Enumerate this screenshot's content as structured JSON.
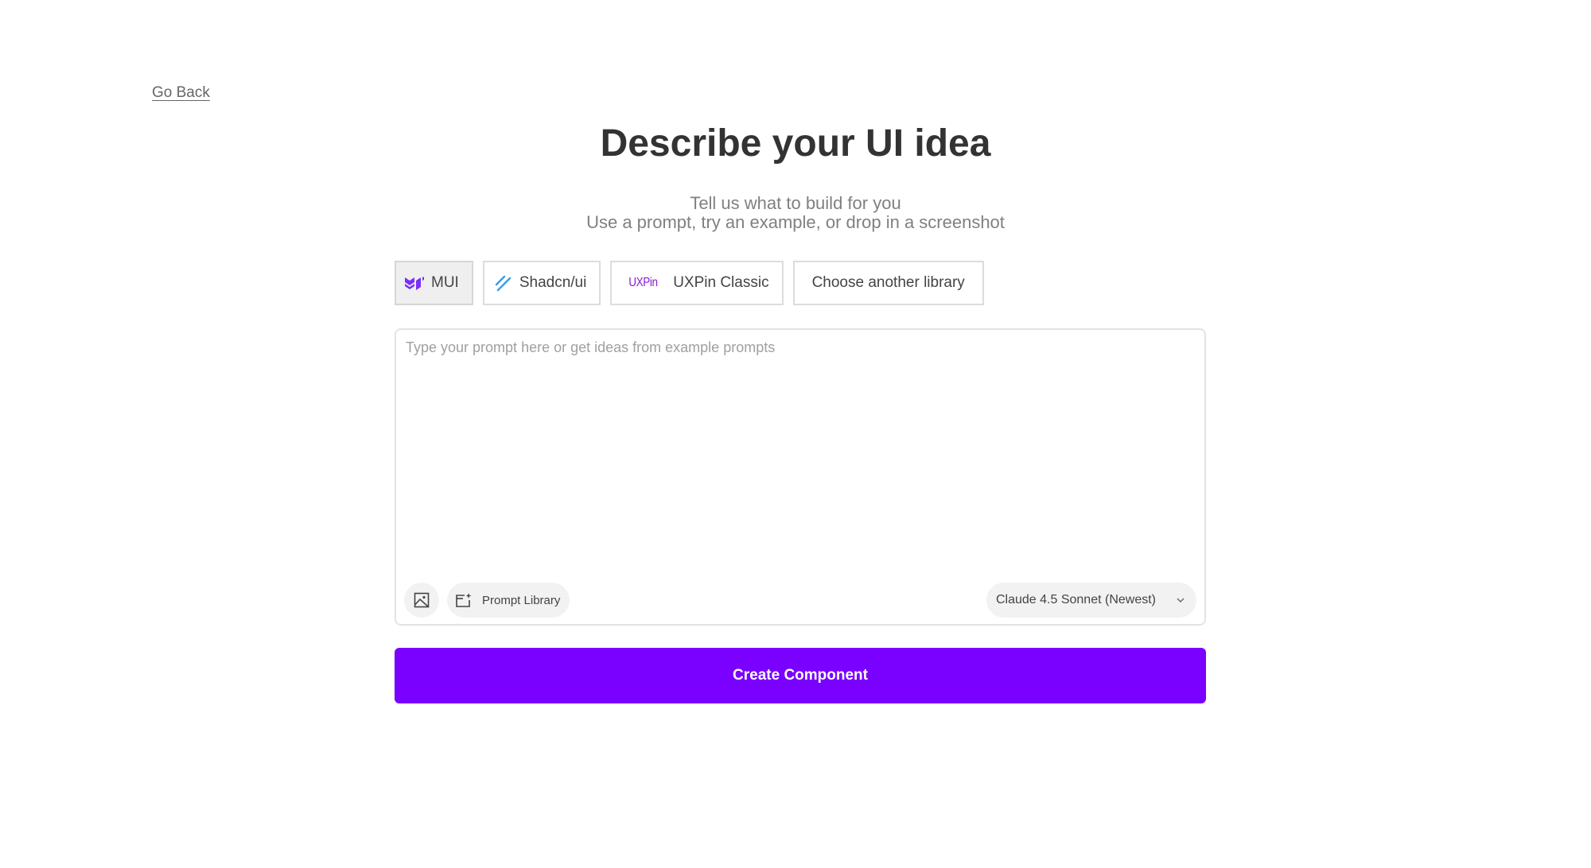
{
  "nav": {
    "go_back_label": "Go Back"
  },
  "header": {
    "title": "Describe your UI idea",
    "subtitle_line1": "Tell us what to build for you",
    "subtitle_line2": "Use a prompt, try an example, or drop in a screenshot"
  },
  "libraries": {
    "items": [
      {
        "label": "MUI",
        "icon": "mui-logo-icon",
        "selected": true
      },
      {
        "label": "Shadcn/ui",
        "icon": "shadcn-logo-icon",
        "selected": false
      },
      {
        "label": "UXPin Classic",
        "icon": "uxpin-logo-icon",
        "logo_text": "UXPin",
        "selected": false
      },
      {
        "label": "Choose another library",
        "selected": false
      }
    ]
  },
  "prompt": {
    "value": "",
    "placeholder": "Type your prompt here or get ideas from example prompts",
    "image_upload_icon": "image-icon",
    "prompt_library_label": "Prompt Library",
    "prompt_library_icon": "prompt-library-icon",
    "model_selected": "Claude 4.5 Sonnet (Newest)",
    "model_chevron_icon": "chevron-down-icon"
  },
  "actions": {
    "create_label": "Create Component"
  },
  "colors": {
    "accent": "#7a00ff",
    "mui_logo": "#7b2ff7",
    "shadcn_logo": "#3b9ee8",
    "uxpin_logo": "#8a1ad6"
  }
}
